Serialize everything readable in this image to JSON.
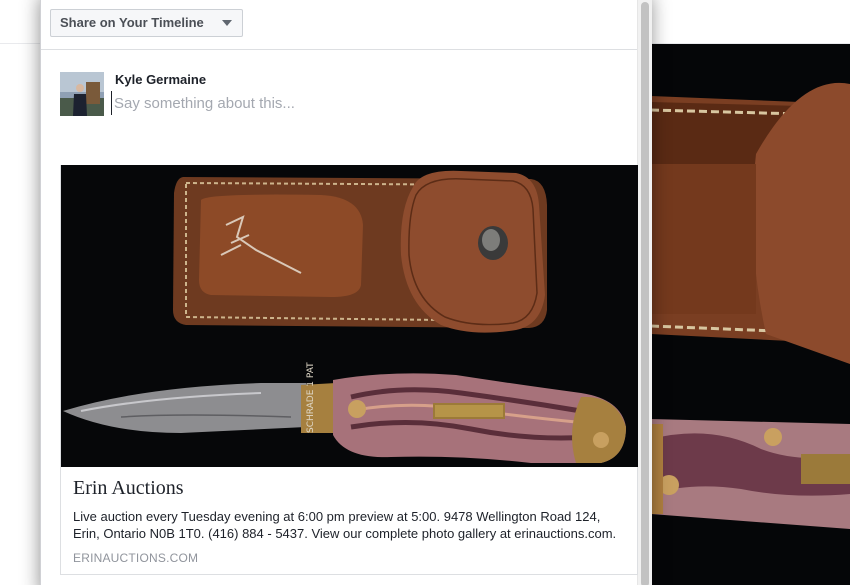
{
  "dialog": {
    "share_target": "Share on Your Timeline"
  },
  "composer": {
    "author_name": "Kyle Germaine",
    "placeholder": "Say something about this..."
  },
  "link_preview": {
    "title": "Erin Auctions",
    "description": "Live auction every Tuesday evening at 6:00 pm preview at 5:00. 9478 Wellington Road 124, Erin, Ontario N0B 1T0. (416) 884 - 5437. View our complete photo gallery at erinauctions.com.",
    "domain": "ERINAUCTIONS.COM",
    "image_subject": "pocket knife with leather sheath",
    "knife_brand_stamp": "SCHRADE 1 PAT"
  },
  "icons": {
    "dropdown": "chevron-down-icon"
  },
  "colors": {
    "dialog_bg": "#ffffff",
    "border": "#dddfe2",
    "text_primary": "#1d2129",
    "text_secondary": "#90949c",
    "placeholder": "#a4a8b0",
    "photo_bg": "#060709",
    "leather": "#8a4a2a"
  }
}
